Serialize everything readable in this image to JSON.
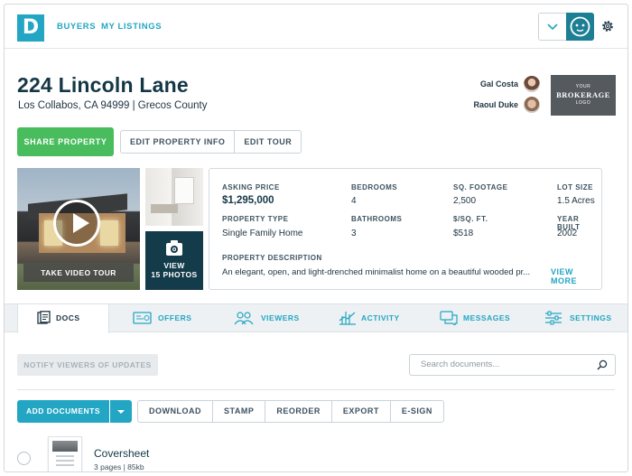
{
  "nav": {
    "logo_letter": "D",
    "links": [
      "BUYERS",
      "MY LISTINGS"
    ],
    "icons": {
      "dropdown": "chevron-down-icon",
      "avatar": "avatar-face-icon",
      "settings": "gear-icon"
    }
  },
  "property": {
    "title": "224 Lincoln Lane",
    "subtitle": "Los Collabos, CA 94999 | Grecos County"
  },
  "agents": [
    {
      "name": "Gal Costa"
    },
    {
      "name": "Raoul Duke"
    }
  ],
  "brokerage": {
    "line1": "YOUR",
    "line2": "BROKERAGE",
    "line3": "LOGO"
  },
  "actions": {
    "share": "SHARE PROPERTY",
    "edit_info": "EDIT PROPERTY INFO",
    "edit_tour": "EDIT TOUR"
  },
  "media": {
    "video_label": "TAKE VIDEO TOUR",
    "photos_line1": "VIEW",
    "photos_line2": "15 PHOTOS"
  },
  "details": {
    "asking_price_label": "ASKING PRICE",
    "asking_price": "$1,295,000",
    "bedrooms_label": "BEDROOMS",
    "bedrooms": "4",
    "sqft_label": "SQ. FOOTAGE",
    "sqft": "2,500",
    "lot_label": "LOT SIZE",
    "lot": "1.5 Acres",
    "type_label": "PROPERTY TYPE",
    "type": "Single Family Home",
    "bathrooms_label": "BATHROOMS",
    "bathrooms": "3",
    "price_sqft_label": "$/SQ. FT.",
    "price_sqft": "$518",
    "year_label": "YEAR BUILT",
    "year": "2002",
    "description_label": "PROPERTY DESCRIPTION",
    "description": "An elegant, open, and light-drenched minimalist home on a beautiful wooded pr...",
    "view_more": "VIEW MORE"
  },
  "tabs": [
    {
      "label": "DOCS",
      "icon": "docs-icon",
      "active": true
    },
    {
      "label": "OFFERS",
      "icon": "offers-icon"
    },
    {
      "label": "VIEWERS",
      "icon": "viewers-icon"
    },
    {
      "label": "ACTIVITY",
      "icon": "activity-icon"
    },
    {
      "label": "MESSAGES",
      "icon": "messages-icon"
    },
    {
      "label": "SETTINGS",
      "icon": "settings-sliders-icon"
    }
  ],
  "docs_toolbar": {
    "notify": "NOTIFY VIEWERS OF UPDATES",
    "search_placeholder": "Search documents...",
    "add_documents": "ADD DOCUMENTS",
    "buttons": [
      "DOWNLOAD",
      "STAMP",
      "REORDER",
      "EXPORT",
      "E-SIGN"
    ]
  },
  "documents": [
    {
      "name": "Coversheet",
      "meta": "3 pages | 85kb"
    }
  ],
  "colors": {
    "accent": "#22a6c3",
    "primary_green": "#49bd5e",
    "dark_navy": "#143746",
    "avatar_teal": "#1c7f94"
  }
}
